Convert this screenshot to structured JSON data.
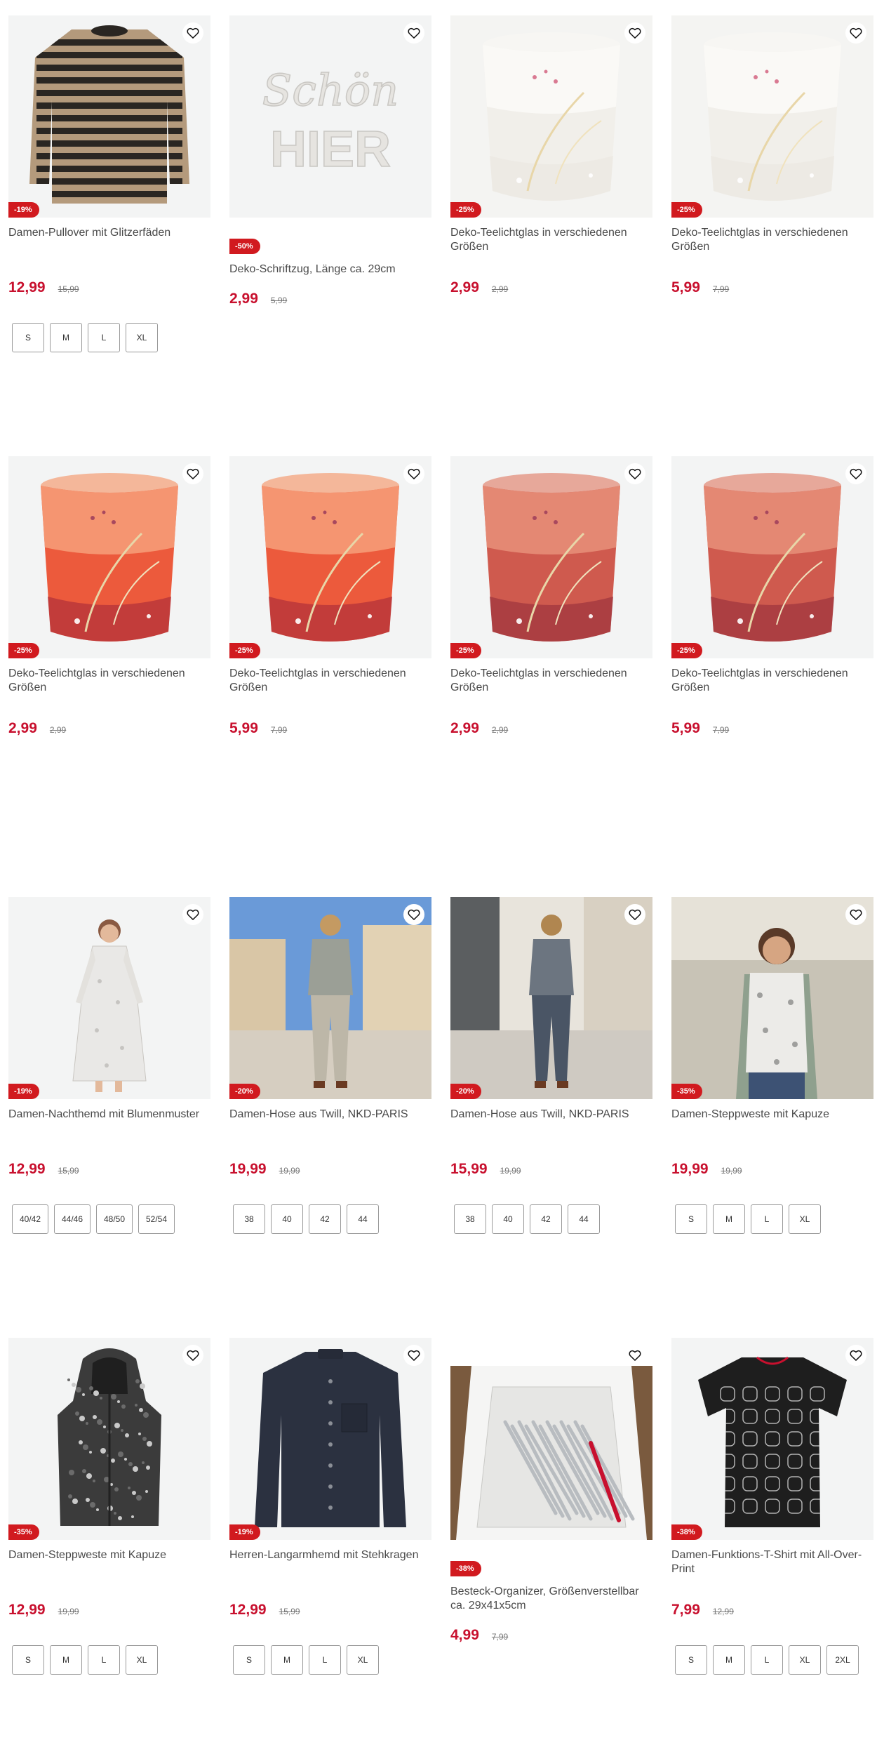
{
  "products": [
    {
      "title": "Damen-Pullover mit Glitzerfäden",
      "price": "12,99",
      "old_price": "15,99",
      "badge": "-19%",
      "sizes": [
        "S",
        "M",
        "L",
        "XL"
      ],
      "art": "pullover"
    },
    {
      "title": "Deko-Schriftzug, Länge ca. 29cm",
      "price": "2,99",
      "old_price": "5,99",
      "badge": "-50%",
      "sizes": [],
      "art": "lettering",
      "lettering": "Schön HIER"
    },
    {
      "title": "Deko-Teelichtglas in verschiedenen Größen",
      "price": "2,99",
      "old_price": "2,99",
      "badge": "-25%",
      "sizes": [],
      "art": "glass-white"
    },
    {
      "title": "Deko-Teelichtglas in verschiedenen Größen",
      "price": "5,99",
      "old_price": "7,99",
      "badge": "-25%",
      "sizes": [],
      "art": "glass-white"
    },
    {
      "title": "Deko-Teelichtglas in verschiedenen Größen",
      "price": "2,99",
      "old_price": "2,99",
      "badge": "-25%",
      "sizes": [],
      "art": "glass-orange"
    },
    {
      "title": "Deko-Teelichtglas in verschiedenen Größen",
      "price": "5,99",
      "old_price": "7,99",
      "badge": "-25%",
      "sizes": [],
      "art": "glass-orange"
    },
    {
      "title": "Deko-Teelichtglas in verschiedenen Größen",
      "price": "2,99",
      "old_price": "2,99",
      "badge": "-25%",
      "sizes": [],
      "art": "glass-rose"
    },
    {
      "title": "Deko-Teelichtglas in verschiedenen Größen",
      "price": "5,99",
      "old_price": "7,99",
      "badge": "-25%",
      "sizes": [],
      "art": "glass-rose"
    },
    {
      "title": "Damen-Nachthemd mit Blumenmuster",
      "price": "12,99",
      "old_price": "15,99",
      "badge": "-19%",
      "sizes": [
        "40/42",
        "44/46",
        "48/50",
        "52/54"
      ],
      "art": "nightgown"
    },
    {
      "title": "Damen-Hose aus Twill, NKD-PARIS",
      "price": "19,99",
      "old_price": "19,99",
      "badge": "-20%",
      "sizes": [
        "38",
        "40",
        "42",
        "44"
      ],
      "art": "street-beige"
    },
    {
      "title": "Damen-Hose aus Twill, NKD-PARIS",
      "price": "15,99",
      "old_price": "19,99",
      "badge": "-20%",
      "sizes": [
        "38",
        "40",
        "42",
        "44"
      ],
      "art": "street-grey"
    },
    {
      "title": "Damen-Steppweste mit Kapuze",
      "price": "19,99",
      "old_price": "19,99",
      "badge": "-35%",
      "sizes": [
        "S",
        "M",
        "L",
        "XL"
      ],
      "art": "vest-model"
    },
    {
      "title": "Damen-Steppweste mit Kapuze",
      "price": "12,99",
      "old_price": "19,99",
      "badge": "-35%",
      "sizes": [
        "S",
        "M",
        "L",
        "XL"
      ],
      "art": "vest"
    },
    {
      "title": "Herren-Langarmhemd mit Stehkragen",
      "price": "12,99",
      "old_price": "15,99",
      "badge": "-19%",
      "sizes": [
        "S",
        "M",
        "L",
        "XL"
      ],
      "art": "shirt"
    },
    {
      "title": "Besteck-Organizer, Größenverstellbar ca. 29x41x5cm",
      "price": "4,99",
      "old_price": "7,99",
      "badge": "-38%",
      "sizes": [],
      "art": "organizer"
    },
    {
      "title": "Damen-Funktions-T-Shirt mit All-Over-Print",
      "price": "7,99",
      "old_price": "12,99",
      "badge": "-38%",
      "sizes": [
        "S",
        "M",
        "L",
        "XL",
        "2XL"
      ],
      "art": "tshirt"
    }
  ],
  "colors": {
    "accent": "#c8102e",
    "badge": "#d11a1f"
  },
  "icons": {
    "wishlist": "heart-outline-icon"
  }
}
